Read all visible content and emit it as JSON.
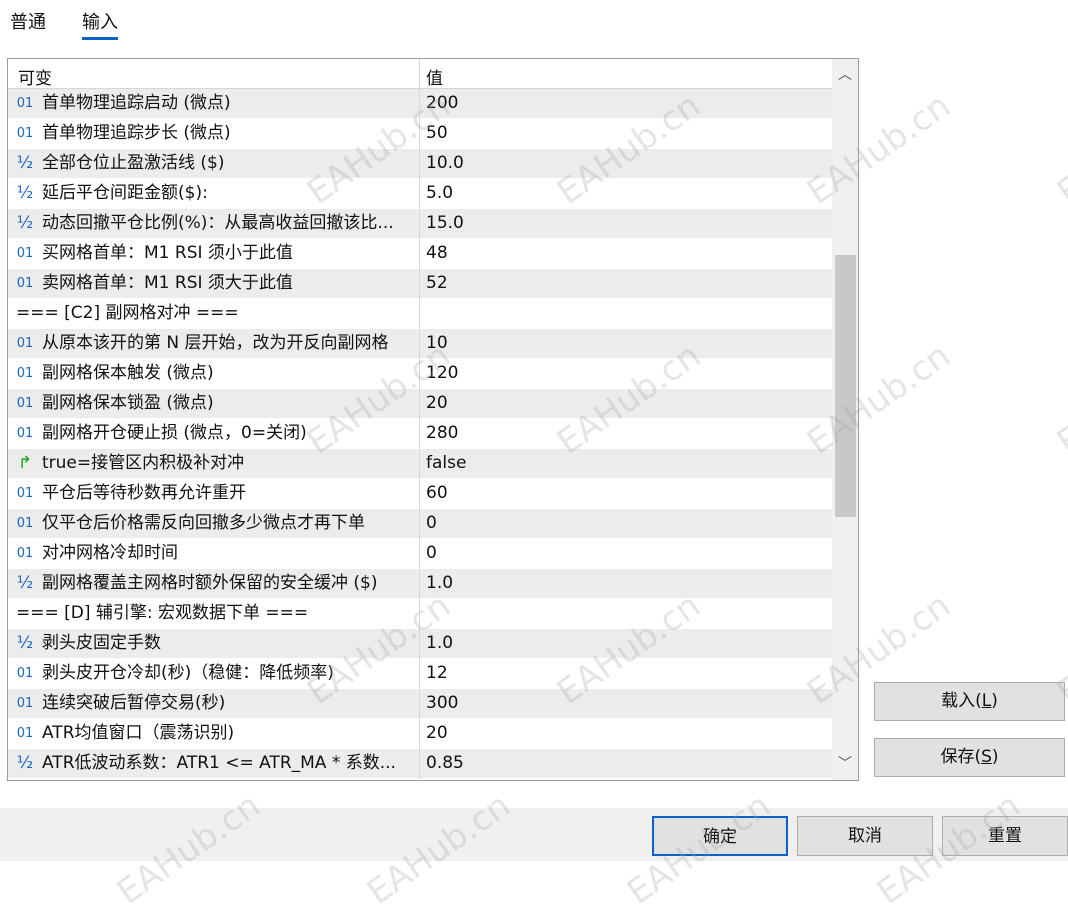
{
  "tabs": [
    {
      "label": "普通",
      "active": false
    },
    {
      "label": "输入",
      "active": true
    }
  ],
  "grid": {
    "header": {
      "col1": "可变",
      "col2": "值"
    },
    "rows": [
      {
        "icon": "int",
        "name": "首单物理追踪启动 (微点)",
        "value": "200"
      },
      {
        "icon": "int",
        "name": "首单物理追踪步长 (微点)",
        "value": "50"
      },
      {
        "icon": "double",
        "name": "全部仓位止盈激活线 ($)",
        "value": "10.0"
      },
      {
        "icon": "double",
        "name": "延后平仓间距金额($):",
        "value": "5.0"
      },
      {
        "icon": "double",
        "name": "动态回撤平仓比例(%)：从最高收益回撤该比...",
        "value": "15.0"
      },
      {
        "icon": "int",
        "name": "买网格首单：M1 RSI 须小于此值",
        "value": "48"
      },
      {
        "icon": "int",
        "name": "卖网格首单：M1 RSI 须大于此值",
        "value": "52"
      },
      {
        "icon": "none",
        "name": "=== [C2] 副网格对冲 ===",
        "value": ""
      },
      {
        "icon": "int",
        "name": "从原本该开的第 N 层开始，改为开反向副网格",
        "value": "10"
      },
      {
        "icon": "int",
        "name": "副网格保本触发 (微点)",
        "value": "120"
      },
      {
        "icon": "int",
        "name": "副网格保本锁盈 (微点)",
        "value": "20"
      },
      {
        "icon": "int",
        "name": "副网格开仓硬止损 (微点，0=关闭)",
        "value": "280"
      },
      {
        "icon": "bool",
        "name": "true=接管区内积极补对冲",
        "value": "false"
      },
      {
        "icon": "int",
        "name": "平仓后等待秒数再允许重开",
        "value": "60"
      },
      {
        "icon": "int",
        "name": "仅平仓后价格需反向回撤多少微点才再下单",
        "value": "0"
      },
      {
        "icon": "int",
        "name": "对冲网格冷却时间",
        "value": "0"
      },
      {
        "icon": "double",
        "name": "副网格覆盖主网格时额外保留的安全缓冲 ($)",
        "value": "1.0"
      },
      {
        "icon": "none",
        "name": "=== [D] 辅引擎: 宏观数据下单 ===",
        "value": ""
      },
      {
        "icon": "double",
        "name": "剥头皮固定手数",
        "value": "1.0"
      },
      {
        "icon": "int",
        "name": "剥头皮开仓冷却(秒)（稳健：降低频率)",
        "value": "12"
      },
      {
        "icon": "int",
        "name": "连续突破后暂停交易(秒)",
        "value": "300"
      },
      {
        "icon": "int",
        "name": "ATR均值窗口（震荡识别)",
        "value": "20"
      },
      {
        "icon": "double",
        "name": "ATR低波动系数：ATR1 <= ATR_MA * 系数...",
        "value": "0.85"
      }
    ]
  },
  "icons": {
    "int": "01",
    "double": "½",
    "bool": "↱"
  },
  "buttons": {
    "load": {
      "text": "载入(",
      "accel": "L",
      "close": ")"
    },
    "save": {
      "text": "保存(",
      "accel": "S",
      "close": ")"
    },
    "ok": "确定",
    "cancel": "取消",
    "reset": "重置"
  },
  "watermark": "EAHub.cn",
  "colors": {
    "accent": "#0a64c8",
    "int_icon": "#1a66c4",
    "bool_icon": "#16a516"
  }
}
